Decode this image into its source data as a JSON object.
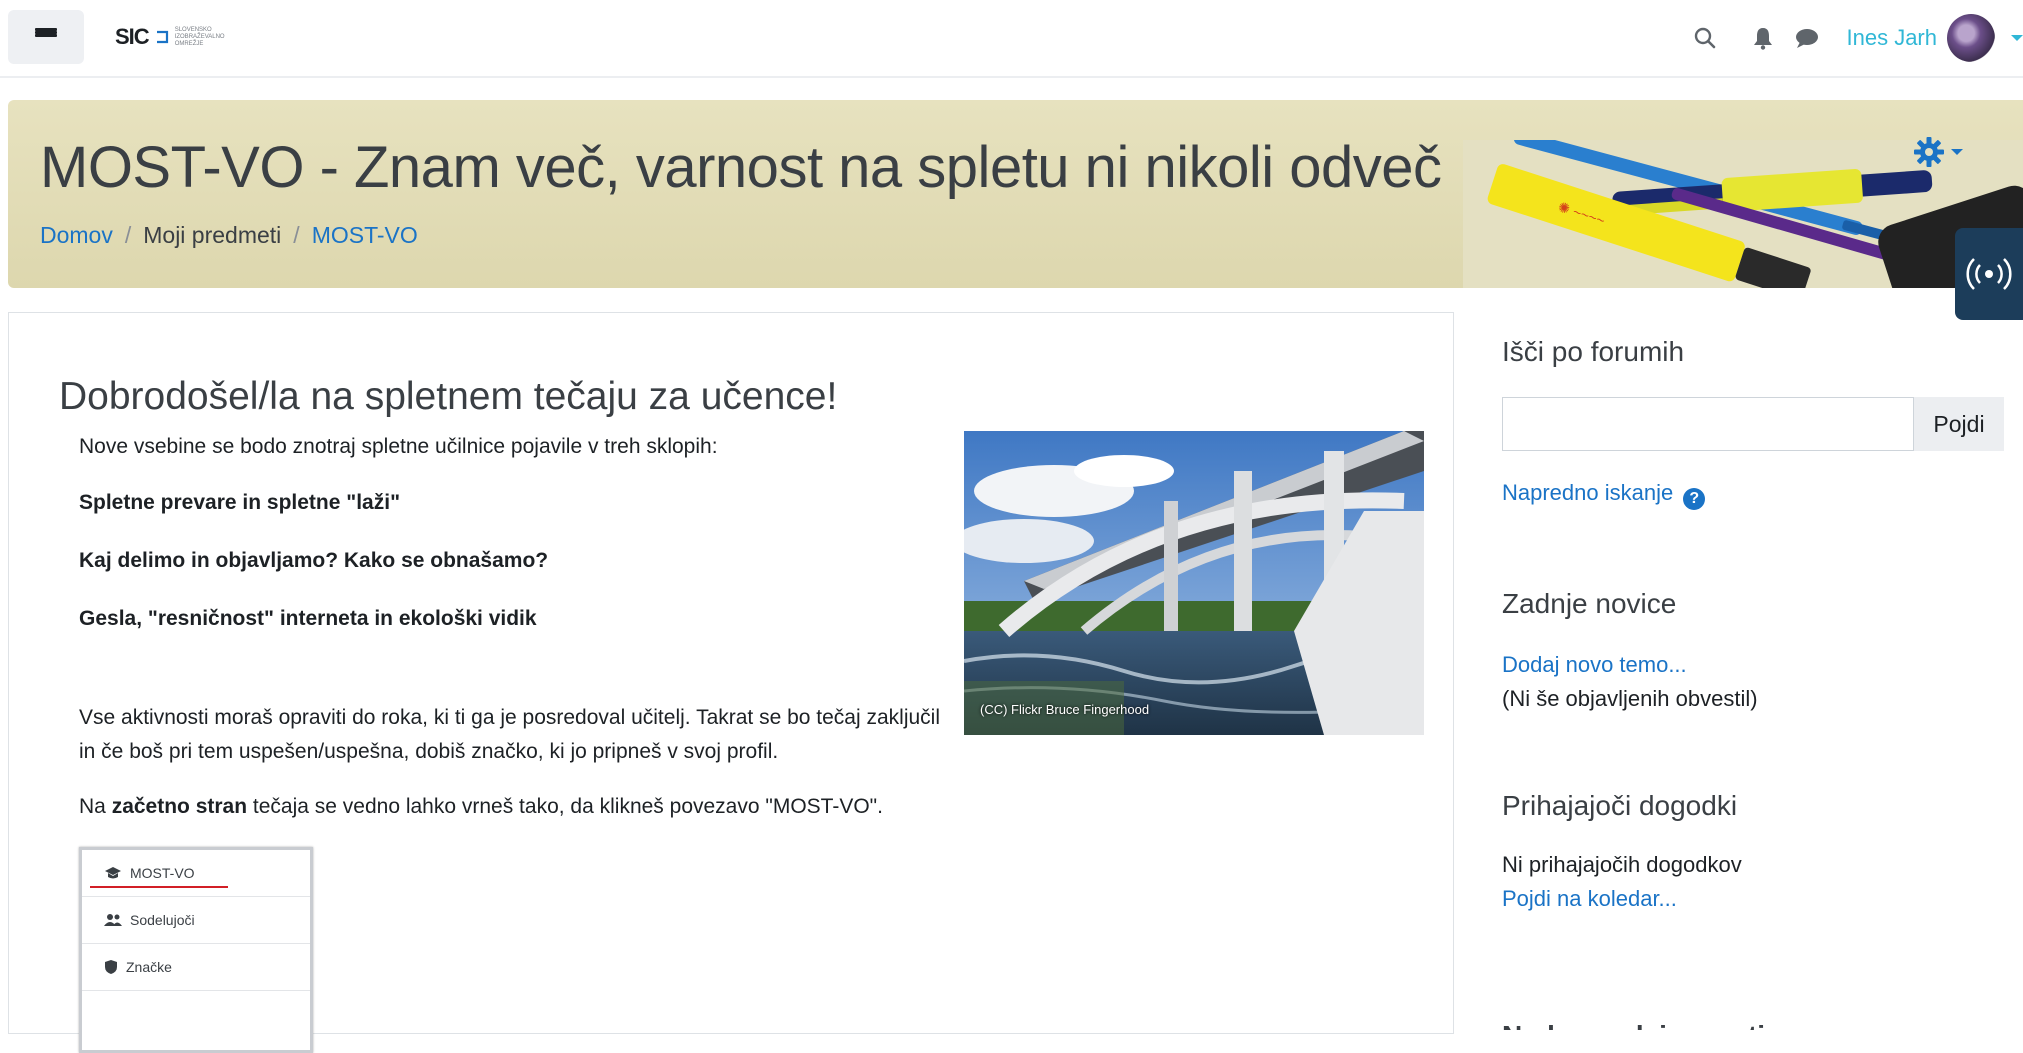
{
  "navbar": {
    "logo_text": "SIC",
    "logo_subtext": "SLOVENSKO IZOBRAŽEVALNO OMREŽJE",
    "user_name": "Ines Jarh",
    "icons": [
      "menu-icon",
      "search-icon",
      "bell-icon",
      "chat-icon",
      "caret-down-icon"
    ]
  },
  "header": {
    "title": "MOST-VO - Znam več, varnost na spletu ni nikoli odveč",
    "breadcrumb": [
      "Domov",
      "Moji predmeti",
      "MOST-VO"
    ],
    "breadcrumb_sep": "/",
    "gear_icon": "gear-icon"
  },
  "main": {
    "welcome": "Dobrodošel/la na spletnem tečaju za učence!",
    "intro": "Nove vsebine se bodo znotraj spletne učilnice pojavile v treh sklopih:",
    "sections": [
      "Spletne prevare in spletne \"laži\"",
      "Kaj delimo in objavljamo? Kako se obnašamo?",
      "Gesla, \"resničnost\" interneta  in ekološki vidik"
    ],
    "deadline_text": "Vse aktivnosti moraš opraviti do roka, ki ti ga je posredoval učitelj.  Takrat se bo tečaj zaključil in če boš pri tem uspešen/uspešna, dobiš značko, ki jo pripneš v svoj profil.",
    "return_prefix": "Na ",
    "return_bold": "začetno stran",
    "return_suffix": " tečaja se vedno lahko vrneš tako, da klikneš povezavo \"MOST-VO\".",
    "image_caption": "(CC) Flickr Bruce Fingerhood",
    "mini_menu": [
      "MOST-VO",
      "Sodelujoči",
      "Značke"
    ]
  },
  "sidebar": {
    "forum_search": {
      "title": "Išči po forumih",
      "input_value": "",
      "button_label": "Pojdi",
      "advanced_link": "Napredno iskanje"
    },
    "latest_news": {
      "title": "Zadnje novice",
      "add_link": "Dodaj novo temo...",
      "empty_text": "(Ni še objavljenih obvestil)"
    },
    "upcoming_events": {
      "title": "Prihajajoči dogodki",
      "empty_text": "Ni prihajajočih dogodkov",
      "calendar_link": "Pojdi na koledar..."
    },
    "recent_activity_title": "Nedavne dejavnosti"
  },
  "colors": {
    "link": "#1a73c6",
    "user_name": "#30b7d6",
    "banner": "#e3ddb7",
    "side_tab": "#1c3d5a",
    "underline_red": "#d21f26"
  }
}
